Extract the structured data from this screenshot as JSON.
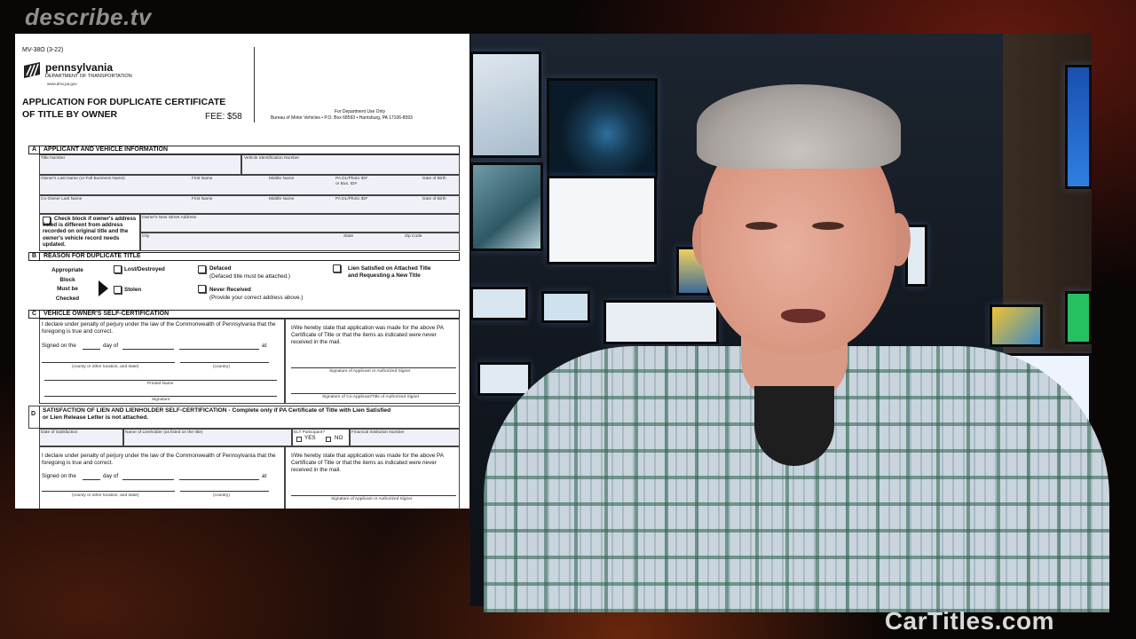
{
  "watermark": "describe.tv",
  "site": "CarTitles.com",
  "form": {
    "number": "MV-38O (3-22)",
    "brand": "pennsylvania",
    "department": "DEPARTMENT OF TRANSPORTATION",
    "website": "www.dmv.pa.gov",
    "title_line1": "APPLICATION FOR DUPLICATE CERTIFICATE",
    "title_line2": "OF TITLE BY OWNER",
    "fee": "FEE: $58",
    "dept_use": "For Department Use Only",
    "bureau": "Bureau of Motor Vehicles • P.O. Box 68593 • Harrisburg, PA 17106-8593"
  },
  "section_a": {
    "letter": "A",
    "title": "APPLICANT AND VEHICLE INFORMATION",
    "title_number": "Title Number",
    "vin": "Vehicle Identification Number",
    "owner_last": "Owner's Last Name (or Full Business Name)",
    "first_name": "First Name",
    "middle_name": "Middle Name",
    "pa_dl_line1": "PA DL/Photo ID#",
    "pa_dl_line2": "or Bus. ID#",
    "dob": "Date of Birth",
    "coowner_last": "Co-Owner Last Name",
    "co_first_name": "First Name",
    "co_middle_name": "Middle Name",
    "co_pa_dl": "PA DL/Photo ID#",
    "co_dob": "Date of Birth",
    "check_text": "Check block if owner's address listed is different from address recorded on original title and the owner's vehicle record needs updated.",
    "street": "Owner's New Street Address",
    "city": "City",
    "state": "State",
    "zip": "Zip Code"
  },
  "section_b": {
    "letter": "B",
    "title": "REASON FOR DUPLICATE TITLE",
    "instruction_1": "Appropriate",
    "instruction_2": "Block",
    "instruction_3": "Must be",
    "instruction_4": "Checked",
    "lost": "Lost/Destroyed",
    "stolen": "Stolen",
    "defaced": "Defaced",
    "defaced_note": "(Defaced title must be attached.)",
    "never_received": "Never Received",
    "never_received_note": "(Provide your correct address above.)",
    "lien_line1": "Lien Satisfied on Attached Title",
    "lien_line2": "and Requesting a New Title"
  },
  "section_c": {
    "letter": "C",
    "title": "VEHICLE OWNER'S SELF-CERTIFICATION",
    "declare": "I declare under penalty of perjury under the law of the Commonwealth of Pennsylvania that the foregoing is true and correct.",
    "signed_on": "Signed on the",
    "day_of": "day of",
    "at": "at",
    "county_label": "(county or other location, and state)",
    "country_label": "(country)",
    "printed_name": "Printed Name",
    "signature": "Signature",
    "hereby": "I/We hereby state that application was made for the above PA Certificate of Title or that the items as indicated were never received in the mail.",
    "sig_applicant": "Signature of Applicant or Authorized Signer",
    "sig_coapplicant": "Signature of Co-Applicant/Title of Authorized Signer"
  },
  "section_d": {
    "letter": "D",
    "title": "SATISFACTION OF LIEN AND LIENHOLDER SELF-CERTIFICATION",
    "title_rest": " - Complete only if PA Certificate of Title with Lien Satisfied",
    "title_line2": "or Lien Release Letter is not attached.",
    "date_satisfaction": "Date of Satisfaction",
    "lienholder_name": "Name of Lienholder (as listed on the title)",
    "elt": "ELT Participant?",
    "yes": "YES",
    "no": "NO",
    "fin_number": "Financial Institution Number",
    "declare": "I declare under penalty of perjury under the law of the Commonwealth of Pennsylvania that the foregoing is true and correct.",
    "signed_on": "Signed on the",
    "day_of": "day of",
    "at": "at",
    "county_label": "(county or other location, and state)",
    "country_label": "(country)",
    "hereby": "I/We hereby state that application was made for the above PA Certificate of Title or that the items as indicated were never received in the mail.",
    "sig_applicant": "Signature of Applicant or Authorized Signer"
  }
}
